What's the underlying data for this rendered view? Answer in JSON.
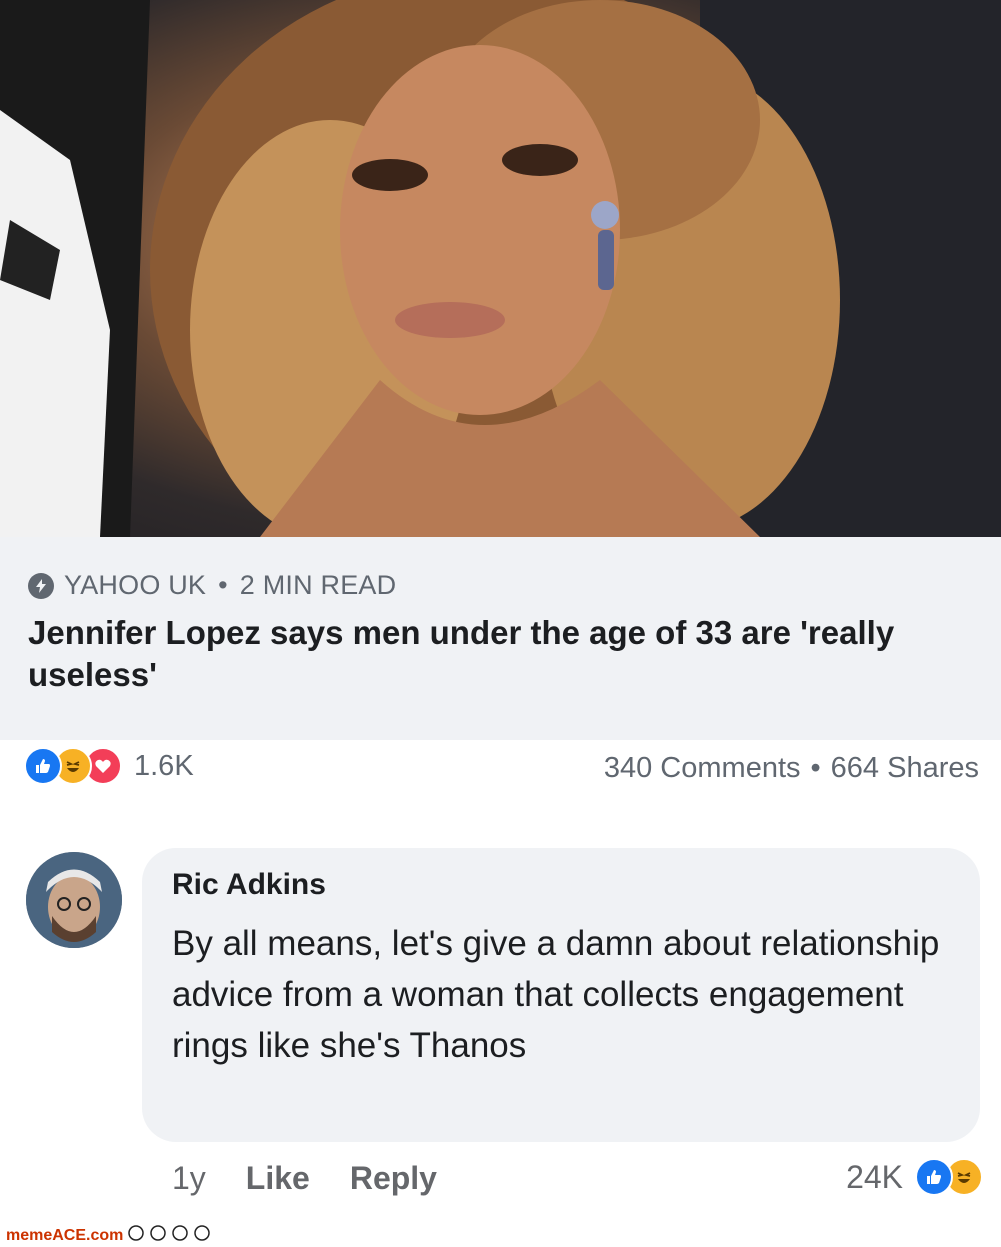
{
  "post": {
    "photo_alt": "photo-of-woman",
    "source": {
      "icon": "lightning-bolt-icon",
      "name": "YAHOO UK",
      "separator": "•",
      "read_time": "2 MIN READ"
    },
    "headline": "Jennifer Lopez says men under the age of 33 are 'really useless'",
    "reactions": {
      "icons": [
        "like-icon",
        "haha-icon",
        "love-icon"
      ],
      "count": "1.6K"
    },
    "comments_count": "340 Comments",
    "stats_separator": "•",
    "shares_count": "664 Shares"
  },
  "comment": {
    "author": "Ric Adkins",
    "text": "By all means,  let's give a damn about relationship advice from a woman that collects engagement rings like she's Thanos",
    "time": "1y",
    "like_label": "Like",
    "reply_label": "Reply",
    "reaction_count": "24K"
  },
  "watermark": {
    "text": "memeACE.com"
  },
  "colors": {
    "like": "#1877f2",
    "haha": "#f7b125",
    "love": "#f33e58",
    "meta_text": "#606770",
    "bubble": "#f0f2f5"
  }
}
